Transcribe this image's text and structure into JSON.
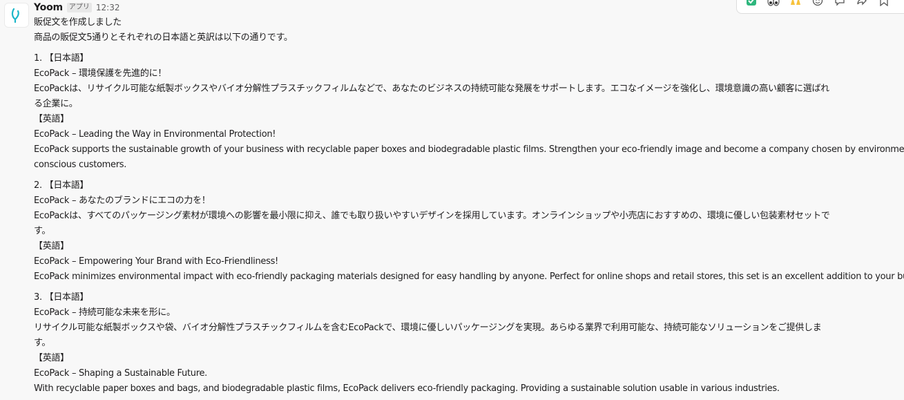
{
  "message": {
    "sender": "Yoom",
    "badge": "アプリ",
    "time": "12:32",
    "lines": [
      "販促文を作成しました",
      "商品の販促文5通りとそれぞれの日本語と英訳は以下の通りです。",
      "",
      "1. 【日本語】",
      "EcoPack – 環境保護を先進的に！",
      "EcoPackは、リサイクル可能な紙製ボックスやバイオ分解性プラスチックフィルムなどで、あなたのビジネスの持続可能な発展をサポートします。エコなイメージを強化し、環境意識の高い顧客に選ばれ",
      "る企業に。",
      "【英語】",
      "EcoPack – Leading the Way in Environmental Protection!",
      "EcoPack supports the sustainable growth of your business with recyclable paper boxes and biodegradable plastic films. Strengthen your eco-friendly image and become a company chosen by environmentally",
      "conscious customers.",
      "",
      "2. 【日本語】",
      "EcoPack – あなたのブランドにエコの力を！",
      "EcoPackは、すべてのパッケージング素材が環境への影響を最小限に抑え、誰でも取り扱いやすいデザインを採用しています。オンラインショップや小売店におすすめの、環境に優しい包装素材セットで",
      "す。",
      "【英語】",
      "EcoPack – Empowering Your Brand with Eco-Friendliness!",
      "EcoPack minimizes environmental impact with eco-friendly packaging materials designed for easy handling by anyone. Perfect for online shops and retail stores, this set is an excellent addition to your business",
      "",
      "3. 【日本語】",
      "EcoPack – 持続可能な未来を形に。",
      "リサイクル可能な紙製ボックスや袋、バイオ分解性プラスチックフィルムを含むEcoPackで、環境に優しいパッケージングを実現。あらゆる業界で利用可能な、持続可能なソリューションをご提供しま",
      "す。",
      "【英語】",
      "EcoPack – Shaping a Sustainable Future.",
      "With recyclable paper boxes and bags, and biodegradable plastic films, EcoPack delivers eco-friendly packaging. Providing a sustainable solution usable in various industries."
    ]
  },
  "toolbar": {
    "icons": [
      "check-mark-icon",
      "eyes-icon",
      "raised-hands-icon",
      "add-reaction-icon",
      "reply-in-thread-icon",
      "share-message-icon",
      "bookmark-icon",
      "more-actions-icon"
    ]
  },
  "colors": {
    "background": "#f8f8f8",
    "text": "#1d1c1d",
    "muted": "#616061",
    "avatar_accent": "#1cb7c9"
  }
}
